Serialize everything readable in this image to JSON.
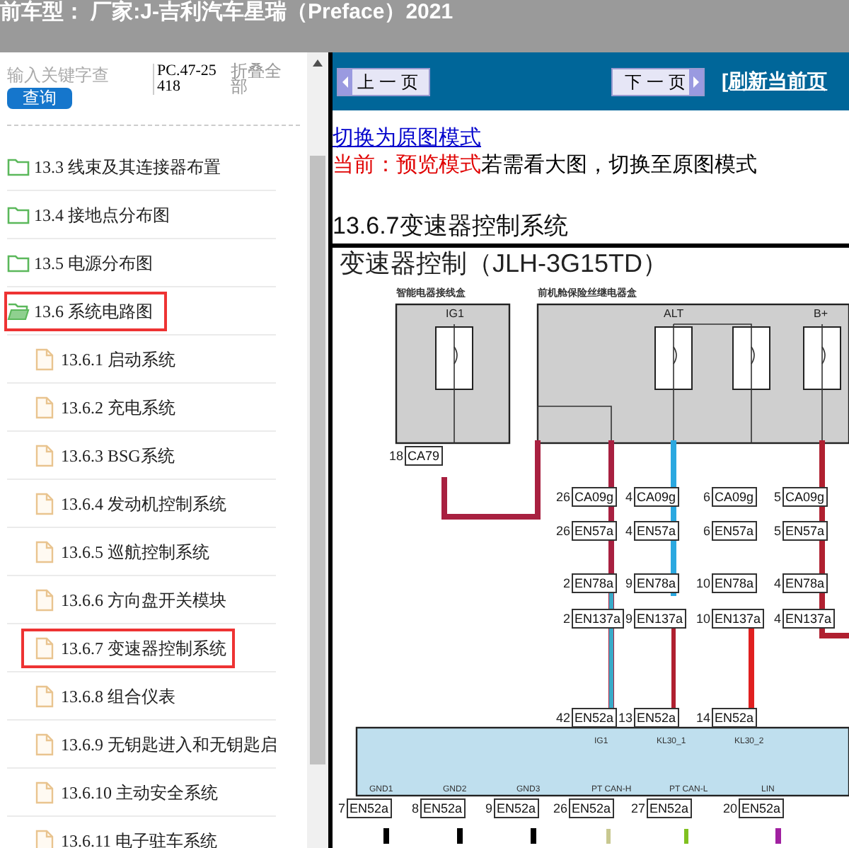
{
  "header": {
    "title": "前车型： 厂家:J-吉利汽车星瑞（Preface）2021"
  },
  "sidebar": {
    "search": {
      "placeholder": "输入关键字查"
    },
    "search_button": "查询",
    "code": "PC.47-25418",
    "collapse_all": "折叠全部",
    "tree": [
      {
        "label": "13.3 线束及其连接器布置",
        "kind": "folder",
        "expanded": false,
        "highlighted": false
      },
      {
        "label": "13.4 接地点分布图",
        "kind": "folder",
        "expanded": false,
        "highlighted": false
      },
      {
        "label": "13.5 电源分布图",
        "kind": "folder",
        "expanded": false,
        "highlighted": false
      },
      {
        "label": "13.6 系统电路图",
        "kind": "folder",
        "expanded": true,
        "highlighted": true,
        "children": [
          {
            "label": "13.6.1 启动系统",
            "kind": "page",
            "highlighted": false
          },
          {
            "label": "13.6.2 充电系统",
            "kind": "page",
            "highlighted": false
          },
          {
            "label": "13.6.3 BSG系统",
            "kind": "page",
            "highlighted": false
          },
          {
            "label": "13.6.4 发动机控制系统",
            "kind": "page",
            "highlighted": false
          },
          {
            "label": "13.6.5 巡航控制系统",
            "kind": "page",
            "highlighted": false
          },
          {
            "label": "13.6.6 方向盘开关模块",
            "kind": "page",
            "highlighted": false
          },
          {
            "label": "13.6.7 变速器控制系统",
            "kind": "page",
            "highlighted": true
          },
          {
            "label": "13.6.8 组合仪表",
            "kind": "page",
            "highlighted": false
          },
          {
            "label": "13.6.9 无钥匙进入和无钥匙启",
            "kind": "page",
            "highlighted": false
          },
          {
            "label": "13.6.10 主动安全系统",
            "kind": "page",
            "highlighted": false
          },
          {
            "label": "13.6.11 电子驻车系统",
            "kind": "page",
            "highlighted": false
          }
        ]
      }
    ]
  },
  "content": {
    "prev_button": "上 一 页",
    "next_button": "下 一 页",
    "refresh_link": "[刷新当前页",
    "switch_link": "切换为原图模式",
    "mode_label": "当前：预览模式",
    "mode_hint": "若需看大图，切换至原图模式",
    "section_title": "13.6.7变速器控制系统",
    "diagram": {
      "title": "变速器控制（JLH-3G15TD）",
      "box_captions": [
        "智能电器接线盒",
        "前机舱保险丝继电器盒"
      ],
      "fuse_labels": [
        "IG1",
        "ALT",
        "B+"
      ],
      "connector_rows": [
        [
          {
            "pin": "18",
            "name": "CA79"
          }
        ],
        [
          {
            "pin": "26",
            "name": "CA09g"
          },
          {
            "pin": "4",
            "name": "CA09g"
          },
          {
            "pin": "6",
            "name": "CA09g"
          },
          {
            "pin": "5",
            "name": "CA09g"
          }
        ],
        [
          {
            "pin": "26",
            "name": "EN57a"
          },
          {
            "pin": "4",
            "name": "EN57a"
          },
          {
            "pin": "6",
            "name": "EN57a"
          },
          {
            "pin": "5",
            "name": "EN57a"
          }
        ],
        [
          {
            "pin": "2",
            "name": "EN78a"
          },
          {
            "pin": "9",
            "name": "EN78a"
          },
          {
            "pin": "10",
            "name": "EN78a"
          },
          {
            "pin": "4",
            "name": "EN78a"
          }
        ],
        [
          {
            "pin": "2",
            "name": "EN137a"
          },
          {
            "pin": "9",
            "name": "EN137a"
          },
          {
            "pin": "10",
            "name": "EN137a"
          },
          {
            "pin": "4",
            "name": "EN137a"
          }
        ],
        [
          {
            "pin": "42",
            "name": "EN52a"
          },
          {
            "pin": "13",
            "name": "EN52a"
          },
          {
            "pin": "14",
            "name": "EN52a"
          }
        ],
        [
          {
            "pin": "7",
            "name": "EN52a"
          },
          {
            "pin": "8",
            "name": "EN52a"
          },
          {
            "pin": "9",
            "name": "EN52a"
          },
          {
            "pin": "26",
            "name": "EN52a"
          },
          {
            "pin": "27",
            "name": "EN52a"
          },
          {
            "pin": "20",
            "name": "EN52a"
          }
        ]
      ],
      "module_top_pins": [
        "IG1",
        "KL30_1",
        "KL30_2"
      ],
      "module_bottom_pins": [
        "GND1",
        "GND2",
        "GND3",
        "PT CAN-H",
        "PT CAN-L",
        "LIN"
      ]
    }
  }
}
